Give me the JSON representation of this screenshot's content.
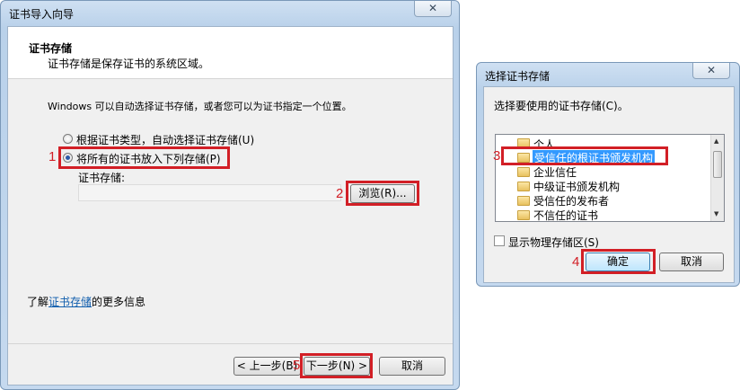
{
  "wizard": {
    "title": "证书导入向导",
    "close_label": "✕",
    "header_title": "证书存储",
    "header_subtitle": "证书存储是保存证书的系统区域。",
    "description": "Windows 可以自动选择证书存储，或者您可以为证书指定一个位置。",
    "option_auto": "根据证书类型，自动选择证书存储(U)",
    "option_manual": "将所有的证书放入下列存储(P)",
    "store_label": "证书存储:",
    "store_value": "",
    "browse_label": "浏览(R)...",
    "more_info_prefix": "了解",
    "more_info_link": "证书存储",
    "more_info_suffix": "的更多信息",
    "back_label": "< 上一步(B)",
    "next_label": "下一步(N) >",
    "cancel_label": "取消"
  },
  "store_dialog": {
    "title": "选择证书存储",
    "close_label": "✕",
    "prompt": "选择要使用的证书存储(C)。",
    "stores": [
      "个人",
      "受信任的根证书颁发机构",
      "企业信任",
      "中级证书颁发机构",
      "受信任的发布者",
      "不信任的证书"
    ],
    "selected_index": 1,
    "show_physical": "显示物理存储区(S)",
    "ok_label": "确定",
    "cancel_label": "取消"
  },
  "markers": [
    "1",
    "2",
    "3",
    "4",
    "5"
  ],
  "colors": {
    "highlight": "#d21f26",
    "selection": "#3399ff",
    "link": "#0f5dad"
  }
}
